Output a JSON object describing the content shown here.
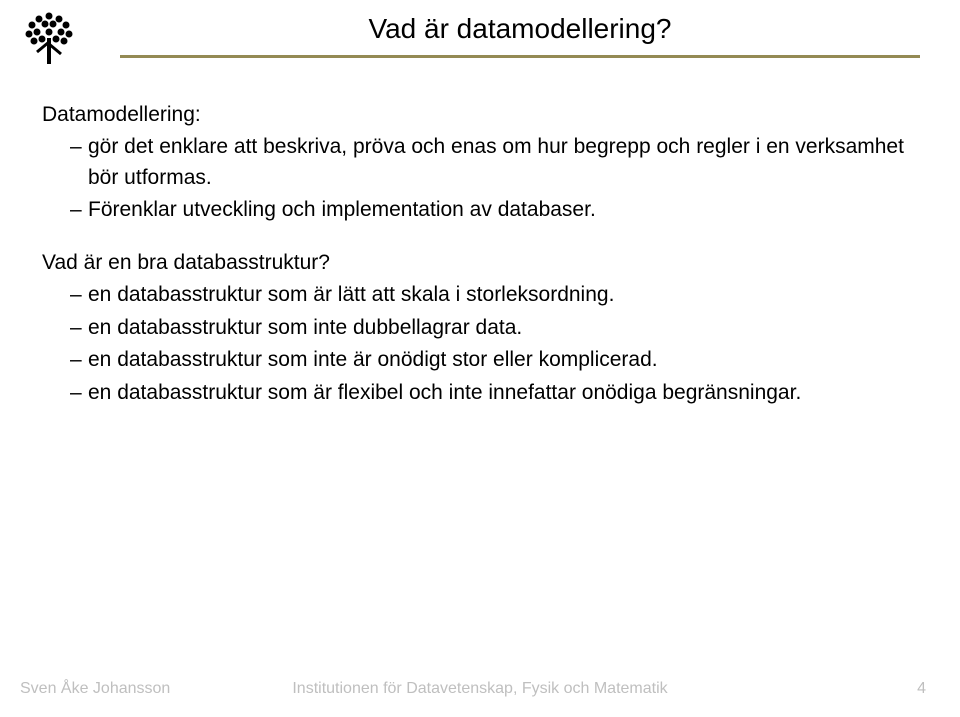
{
  "title": "Vad är datamodellering?",
  "section1": {
    "heading": "Datamodellering:",
    "bullets": [
      "gör det enklare att beskriva, pröva och enas om hur begrepp och regler i en verksamhet bör utformas.",
      "Förenklar utveckling och implementation av databaser."
    ]
  },
  "section2": {
    "heading": "Vad är en bra databasstruktur?",
    "bullets": [
      "en databasstruktur som är lätt att skala i storleksordning.",
      "en databasstruktur som inte dubbellagrar data.",
      "en databasstruktur som inte är onödigt stor eller komplicerad.",
      "en databasstruktur som är flexibel och inte innefattar onödiga begränsningar."
    ]
  },
  "footer": {
    "author": "Sven Åke Johansson",
    "institution": "Institutionen för Datavetenskap, Fysik och Matematik",
    "page": "4"
  },
  "icons": {
    "logo": "tree-dots-icon"
  }
}
